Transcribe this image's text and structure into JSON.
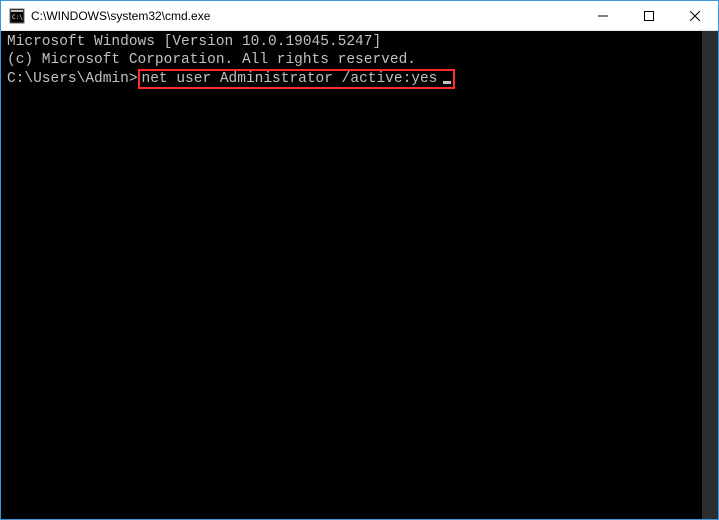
{
  "window": {
    "title": "C:\\WINDOWS\\system32\\cmd.exe"
  },
  "controls": {
    "minimize": "─",
    "maximize": "☐",
    "close": "✕"
  },
  "terminal": {
    "banner_line1": "Microsoft Windows [Version 10.0.19045.5247]",
    "banner_line2": "(c) Microsoft Corporation. All rights reserved.",
    "blank": "",
    "prompt": "C:\\Users\\Admin>",
    "command": "net user Administrator /active:yes"
  }
}
